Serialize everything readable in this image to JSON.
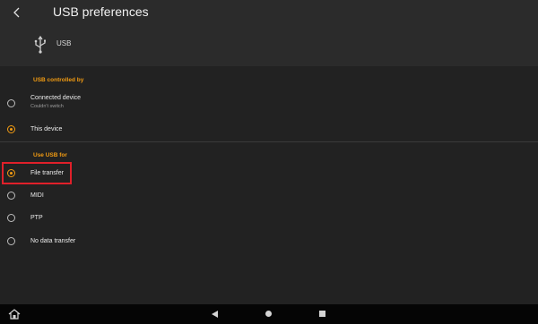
{
  "header": {
    "title": "USB preferences",
    "back_icon": "back-arrow-icon"
  },
  "usb": {
    "icon": "usb-icon",
    "label": "USB"
  },
  "controlled_by": {
    "header": "USB controlled by",
    "options": [
      {
        "label": "Connected device",
        "sublabel": "Couldn't switch",
        "checked": false
      },
      {
        "label": "This device",
        "checked": true
      }
    ]
  },
  "use_for": {
    "header": "Use USB for",
    "options": [
      {
        "label": "File transfer",
        "checked": true
      },
      {
        "label": "MIDI",
        "checked": false
      },
      {
        "label": "PTP",
        "checked": false
      },
      {
        "label": "No data transfer",
        "checked": false
      }
    ]
  },
  "colors": {
    "accent": "#f39c12",
    "highlight": "#e0202a",
    "background": "#222222",
    "header_bg": "#2b2b2b"
  },
  "navbar": {
    "icons": [
      "home-icon",
      "back-triangle-icon",
      "home-circle-icon",
      "recents-square-icon"
    ]
  }
}
